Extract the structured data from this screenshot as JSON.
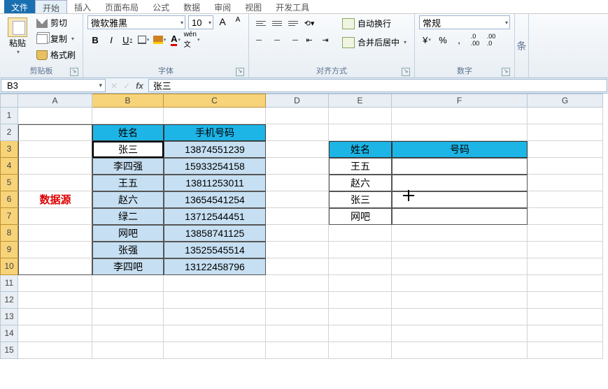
{
  "tabs": {
    "file": "文件",
    "home": "开始",
    "insert": "插入",
    "layout": "页面布局",
    "formulas": "公式",
    "data": "数据",
    "review": "审阅",
    "view": "视图",
    "dev": "开发工具"
  },
  "clipboard": {
    "paste": "粘贴",
    "cut": "剪切",
    "copy": "复制",
    "format_painter": "格式刷",
    "label": "剪贴板"
  },
  "font": {
    "name": "微软雅黑",
    "size": "10",
    "inc": "A",
    "dec": "A",
    "bold": "B",
    "italic": "I",
    "underline": "U",
    "label": "字体"
  },
  "align": {
    "wrap": "自动换行",
    "merge": "合并后居中",
    "label": "对齐方式"
  },
  "number": {
    "format": "常规",
    "label": "数字"
  },
  "style_edge": "条",
  "namebox": "B3",
  "formula": "张三",
  "columns": [
    "A",
    "B",
    "C",
    "D",
    "E",
    "F",
    "G"
  ],
  "rows": [
    "1",
    "2",
    "3",
    "4",
    "5",
    "6",
    "7",
    "8",
    "9",
    "10",
    "11",
    "12",
    "13",
    "14",
    "15"
  ],
  "left": {
    "header": {
      "b": "姓名",
      "c": "手机号码"
    },
    "label": "数据源",
    "data": [
      {
        "b": "张三",
        "c": "13874551239"
      },
      {
        "b": "李四强",
        "c": "15933254158"
      },
      {
        "b": "王五",
        "c": "13811253011"
      },
      {
        "b": "赵六",
        "c": "13654541254"
      },
      {
        "b": "绿二",
        "c": "13712544451"
      },
      {
        "b": "网吧",
        "c": "13858741125"
      },
      {
        "b": "张强",
        "c": "13525545514"
      },
      {
        "b": "李四吧",
        "c": "13122458796"
      }
    ]
  },
  "right": {
    "header": {
      "e": "姓名",
      "f": "号码"
    },
    "data": [
      {
        "e": "王五",
        "f": ""
      },
      {
        "e": "赵六",
        "f": ""
      },
      {
        "e": "张三",
        "f": ""
      },
      {
        "e": "网吧",
        "f": ""
      }
    ]
  }
}
